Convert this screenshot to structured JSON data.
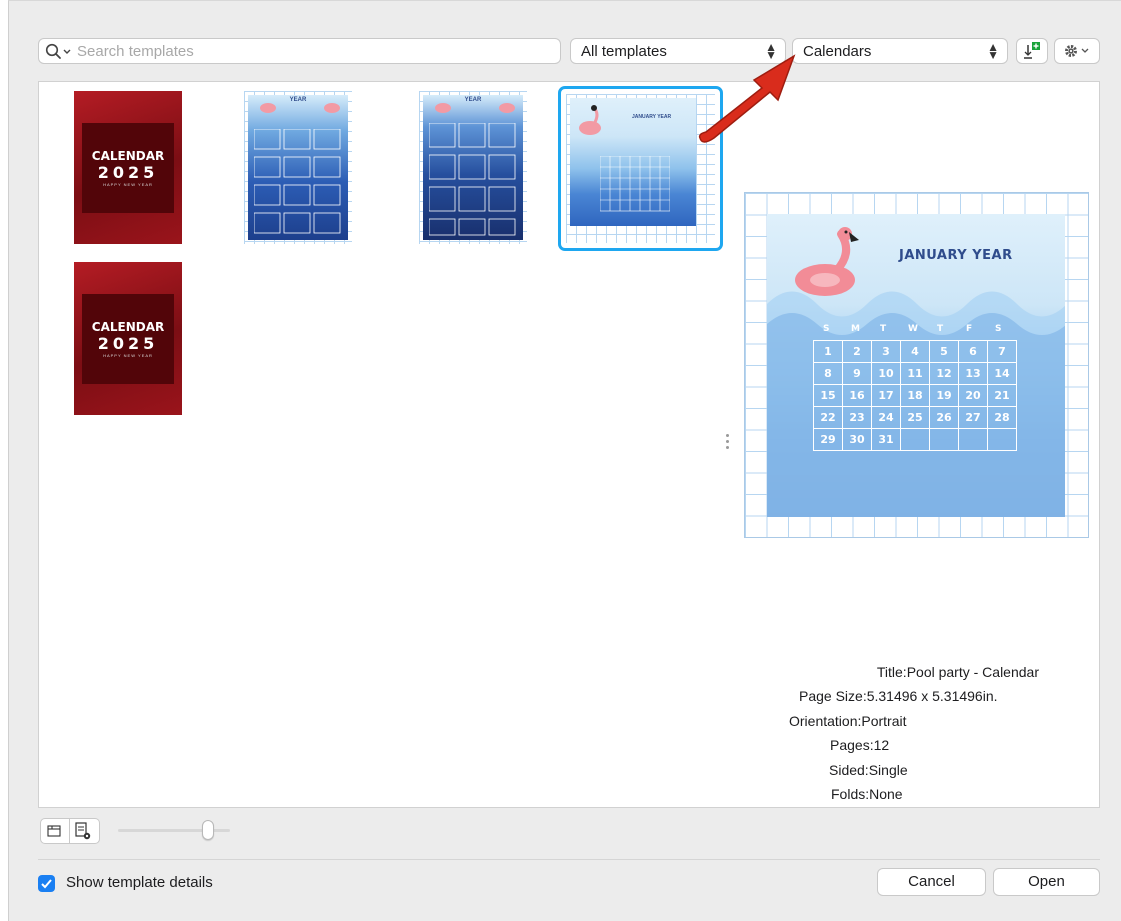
{
  "search": {
    "placeholder": "Search templates"
  },
  "filters": {
    "source_selected": "All templates",
    "category_selected": "Calendars"
  },
  "thumbnails": [
    {
      "title_line1": "CALENDAR",
      "title_line2": "2025",
      "subtitle": "HAPPY NEW YEAR"
    },
    {
      "heading": "YEAR"
    },
    {
      "heading": "YEAR"
    },
    {
      "heading": "JANUARY YEAR",
      "selected": true
    },
    {
      "title_line1": "CALENDAR",
      "title_line2": "2025",
      "subtitle": "HAPPY NEW YEAR"
    }
  ],
  "preview": {
    "heading": "JANUARY YEAR",
    "weekdays": [
      "S",
      "M",
      "T",
      "W",
      "T",
      "F",
      "S"
    ],
    "weeks": [
      [
        "1",
        "2",
        "3",
        "4",
        "5",
        "6",
        "7"
      ],
      [
        "8",
        "9",
        "10",
        "11",
        "12",
        "13",
        "14"
      ],
      [
        "15",
        "16",
        "17",
        "18",
        "19",
        "20",
        "21"
      ],
      [
        "22",
        "23",
        "24",
        "25",
        "26",
        "27",
        "28"
      ],
      [
        "29",
        "30",
        "31",
        "",
        "",
        "",
        ""
      ]
    ]
  },
  "details": {
    "title_label": "Title:",
    "title_value": "Pool party - Calendar",
    "page_size_label": "Page Size:",
    "page_size_value": "5.31496 x 5.31496in.",
    "orientation_label": "Orientation:",
    "orientation_value": "Portrait",
    "pages_label": "Pages:",
    "pages_value": "12",
    "sided_label": "Sided:",
    "sided_value": "Single",
    "folds_label": "Folds:",
    "folds_value": "None"
  },
  "footer": {
    "show_details_label": "Show template details",
    "show_details_checked": true,
    "cancel_label": "Cancel",
    "open_label": "Open"
  },
  "colors": {
    "accent": "#1a7ff2",
    "selection": "#1ea7f0",
    "arrow": "#d92c1c"
  }
}
